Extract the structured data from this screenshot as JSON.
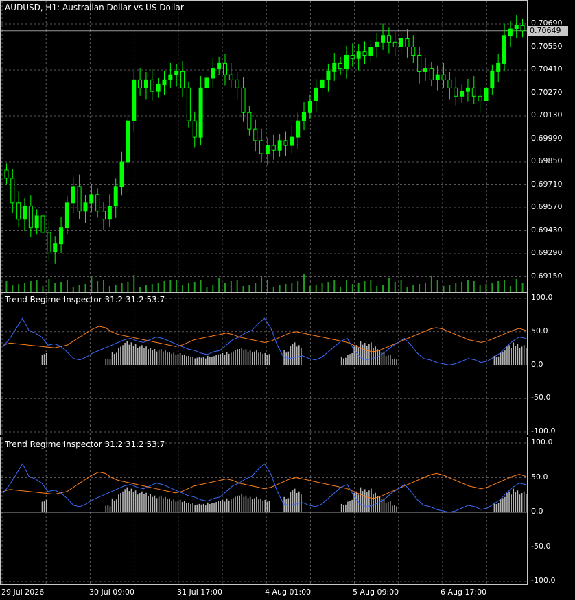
{
  "chart": {
    "title": "AUDUSD, H1:  Australian Dollar vs US Dollar",
    "current_price": "0.70649",
    "price_axis": [
      "0.70690",
      "0.70550",
      "0.70410",
      "0.70270",
      "0.70130",
      "0.69990",
      "0.69850",
      "0.69710",
      "0.69570",
      "0.69430",
      "0.69290",
      "0.69150"
    ],
    "time_axis": [
      "29 Jul 2026",
      "30 Jul 09:00",
      "31 Jul 17:00",
      "4 Aug 01:00",
      "5 Aug 09:00",
      "6 Aug 17:00"
    ],
    "colors": {
      "background": "#000000",
      "candle": "#00ff00",
      "grid": "#5a5a5a",
      "volume": "#1f9a1f",
      "axis": "#c8c8c8"
    }
  },
  "indicator1": {
    "title": "Trend Regime Inspector 31.2 31.2 53.7",
    "axis": [
      "100.0",
      "50.0",
      "0.0",
      "-50.0",
      "-100.0"
    ]
  },
  "indicator2": {
    "title": "Trend Regime Inspector 31.2 31.2 53.7",
    "axis": [
      "100.0",
      "50.0",
      "0.0",
      "-50.0",
      "-100.0"
    ]
  },
  "indicator_colors": {
    "blue_line": "#3b6cff",
    "orange_line": "#ff7f1a",
    "histogram": "#b4b4b4"
  },
  "chart_data": {
    "type": "candlestick",
    "symbol": "AUDUSD",
    "timeframe": "H1",
    "ylim": [
      0.6908,
      0.7075
    ],
    "close_series": [
      0.6975,
      0.696,
      0.695,
      0.6958,
      0.6945,
      0.6952,
      0.6942,
      0.693,
      0.6935,
      0.6945,
      0.696,
      0.697,
      0.6955,
      0.696,
      0.6965,
      0.6955,
      0.695,
      0.6958,
      0.697,
      0.6985,
      0.701,
      0.7035,
      0.703,
      0.7035,
      0.7028,
      0.7032,
      0.7035,
      0.7038,
      0.704,
      0.703,
      0.701,
      0.7,
      0.703,
      0.7036,
      0.7042,
      0.7045,
      0.7038,
      0.7035,
      0.703,
      0.7015,
      0.7005,
      0.6998,
      0.699,
      0.6995,
      0.6992,
      0.6998,
      0.6995,
      0.7,
      0.701,
      0.7015,
      0.7022,
      0.703,
      0.7035,
      0.704,
      0.7045,
      0.7042,
      0.705,
      0.7048,
      0.7052,
      0.705,
      0.7055,
      0.7058,
      0.7062,
      0.7058,
      0.7055,
      0.706,
      0.7055,
      0.705,
      0.704,
      0.7042,
      0.7035,
      0.7038,
      0.7035,
      0.703,
      0.7025,
      0.7028,
      0.703,
      0.7025,
      0.7022,
      0.703,
      0.704,
      0.7045,
      0.7062,
      0.7066,
      0.7068,
      0.70649
    ],
    "indicator": {
      "ylim": [
        -100,
        100
      ],
      "blue": [
        28,
        40,
        55,
        70,
        52,
        48,
        42,
        30,
        32,
        28,
        20,
        10,
        8,
        12,
        18,
        22,
        26,
        30,
        34,
        38,
        40,
        36,
        34,
        38,
        42,
        40,
        36,
        32,
        28,
        24,
        22,
        18,
        16,
        20,
        22,
        30,
        38,
        42,
        48,
        52,
        62,
        70,
        55,
        30,
        12,
        10,
        12,
        14,
        10,
        8,
        12,
        20,
        28,
        36,
        40,
        24,
        12,
        8,
        10,
        14,
        20,
        28,
        34,
        40,
        30,
        18,
        10,
        8,
        4,
        2,
        0,
        2,
        6,
        10,
        8,
        4,
        6,
        12,
        18,
        28,
        36,
        42,
        40
      ],
      "orange": [
        30,
        33,
        32,
        31,
        30,
        29,
        28,
        27,
        26,
        28,
        30,
        36,
        42,
        48,
        54,
        58,
        56,
        50,
        46,
        44,
        42,
        40,
        38,
        36,
        34,
        32,
        30,
        28,
        30,
        34,
        38,
        40,
        42,
        44,
        46,
        48,
        46,
        42,
        40,
        38,
        36,
        34,
        36,
        40,
        44,
        48,
        50,
        48,
        46,
        44,
        42,
        40,
        38,
        36,
        34,
        30,
        26,
        22,
        20,
        22,
        26,
        30,
        34,
        38,
        42,
        46,
        50,
        54,
        56,
        54,
        50,
        46,
        42,
        38,
        36,
        34,
        36,
        40,
        44,
        48,
        52,
        55,
        52
      ],
      "histogram": [
        0,
        0,
        0,
        0,
        0,
        0,
        18,
        0,
        0,
        0,
        0,
        0,
        0,
        0,
        0,
        0,
        10,
        20,
        30,
        36,
        34,
        30,
        28,
        26,
        24,
        22,
        20,
        18,
        16,
        14,
        12,
        12,
        14,
        16,
        18,
        20,
        24,
        26,
        24,
        22,
        20,
        18,
        0,
        0,
        22,
        34,
        30,
        0,
        0,
        0,
        0,
        0,
        0,
        12,
        18,
        30,
        36,
        34,
        28,
        22,
        16,
        10,
        0,
        0,
        0,
        0,
        0,
        0,
        0,
        0,
        0,
        0,
        0,
        0,
        0,
        0,
        0,
        14,
        22,
        30,
        34,
        30,
        28
      ]
    }
  }
}
